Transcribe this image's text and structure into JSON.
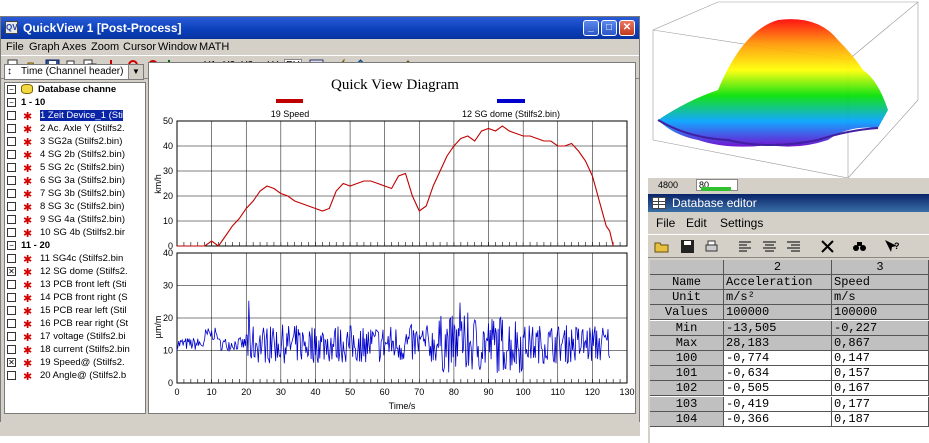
{
  "quickview": {
    "title": "QuickView  1 [Post-Process]",
    "app_icon": "QV",
    "menu": [
      "File",
      "Graph",
      "Axes",
      "Zoom",
      "Cursor",
      "Window",
      "MATH"
    ],
    "toolbar_axis_labels": [
      "Y1",
      "Y2",
      "Y3",
      "LY",
      "RY"
    ],
    "channel_combo": "Time (Channel header)",
    "tree": {
      "root": "Database channe",
      "groups": [
        {
          "label": "1 - 10",
          "channels": [
            {
              "label": "1 Zeit Device_1 (Sti",
              "checked": false,
              "selected": true
            },
            {
              "label": "2 Ac. Axle Y (Stilfs2.",
              "checked": false
            },
            {
              "label": "3 SG2a (Stilfs2.bin)",
              "checked": false
            },
            {
              "label": "4 SG 2b (Stilfs2.bin)",
              "checked": false
            },
            {
              "label": "5 SG 2c (Stilfs2.bin)",
              "checked": false
            },
            {
              "label": "6 SG 3a (Stilfs2.bin)",
              "checked": false
            },
            {
              "label": "7 SG 3b (Stilfs2.bin)",
              "checked": false
            },
            {
              "label": "8 SG 3c (Stilfs2.bin)",
              "checked": false
            },
            {
              "label": "9 SG 4a (Stilfs2.bin)",
              "checked": false
            },
            {
              "label": "10 SG 4b (Stilfs2.bir",
              "checked": false
            }
          ]
        },
        {
          "label": "11 - 20",
          "channels": [
            {
              "label": "11 SG4c (Stilfs2.bin",
              "checked": false
            },
            {
              "label": "12 SG dome (Stilfs2.",
              "checked": true
            },
            {
              "label": "13 PCB front left (Sti",
              "checked": false
            },
            {
              "label": "14 PCB front right (S",
              "checked": false
            },
            {
              "label": "15 PCB rear left (Stil",
              "checked": false
            },
            {
              "label": "16 PCB rear right (St",
              "checked": false
            },
            {
              "label": "17 voltage (Stilfs2.bi",
              "checked": false
            },
            {
              "label": "18 current (Stilfs2.bin",
              "checked": false
            },
            {
              "label": "19 Speed@ (Stilfs2.",
              "checked": true
            },
            {
              "label": "20 Angle@ (Stilfs2.b",
              "checked": false
            }
          ]
        }
      ]
    }
  },
  "chart_data": [
    {
      "type": "line",
      "title": "Quick View Diagram",
      "legend": [
        "19 Speed",
        "12 SG dome (Stilfs2.bin)"
      ],
      "series": [
        {
          "name": "19 Speed",
          "color": "#c00000",
          "x": [
            0,
            8,
            10,
            12,
            14,
            16,
            18,
            20,
            22,
            24,
            26,
            28,
            30,
            32,
            34,
            36,
            38,
            40,
            42,
            44,
            46,
            48,
            50,
            52,
            54,
            56,
            58,
            60,
            62,
            64,
            66,
            68,
            70,
            72,
            74,
            76,
            78,
            80,
            82,
            84,
            86,
            88,
            90,
            92,
            94,
            96,
            98,
            100,
            102,
            104,
            106,
            108,
            110,
            112,
            114,
            116,
            118,
            120,
            122,
            124,
            125,
            126
          ],
          "y": [
            0,
            0,
            2,
            0,
            4,
            8,
            11,
            15,
            18,
            22,
            24,
            23,
            21,
            20,
            18,
            17,
            16,
            15,
            14,
            15,
            22,
            25,
            24,
            25,
            26,
            26,
            25,
            24,
            23,
            28,
            29,
            20,
            14,
            16,
            24,
            30,
            36,
            40,
            43,
            44,
            42,
            46,
            47,
            46,
            48,
            46,
            45,
            44,
            44,
            43,
            42,
            42,
            40,
            40,
            41,
            38,
            34,
            28,
            18,
            8,
            6,
            0
          ],
          "ylabel": "km/h",
          "ylim": [
            0,
            50
          ]
        },
        {
          "name": "12 SG dome (Stilfs2.bin)",
          "color": "#0000cc",
          "ylabel": "µm/m",
          "ylim": [
            0,
            40
          ]
        }
      ],
      "xlabel": "Time/s",
      "xlim": [
        0,
        130
      ],
      "xticks": [
        0,
        10,
        20,
        30,
        40,
        50,
        60,
        70,
        80,
        90,
        100,
        110,
        120,
        130
      ],
      "yticks_top": [
        0,
        10,
        20,
        30,
        40,
        50
      ],
      "yticks_bottom": [
        0,
        10,
        20,
        30,
        40
      ],
      "grid": true
    }
  ],
  "surface_strip": {
    "readout_left": "4800",
    "readout_right": "80"
  },
  "database_editor": {
    "title": "Database editor",
    "menu": [
      "File",
      "Edit",
      "Settings"
    ],
    "col_numbers": [
      "2",
      "3"
    ],
    "rows": [
      {
        "h": "Name",
        "c2": "Acceleration",
        "c3": "Speed"
      },
      {
        "h": "Unit",
        "c2": "m/s²",
        "c3": "m/s"
      },
      {
        "h": "Values",
        "c2": "100000",
        "c3": "100000"
      },
      {
        "h": "Min",
        "c2": "-13,505",
        "c3": "-0,227"
      },
      {
        "h": "Max",
        "c2": "28,183",
        "c3": "0,867"
      },
      {
        "h": "100",
        "c2": "-0,774",
        "c3": "0,147"
      },
      {
        "h": "101",
        "c2": "-0,634",
        "c3": "0,157"
      },
      {
        "h": "102",
        "c2": "-0,505",
        "c3": "0,167"
      },
      {
        "h": "103",
        "c2": "-0,419",
        "c3": "0,177"
      },
      {
        "h": "104",
        "c2": "-0,366",
        "c3": "0,187"
      }
    ]
  }
}
